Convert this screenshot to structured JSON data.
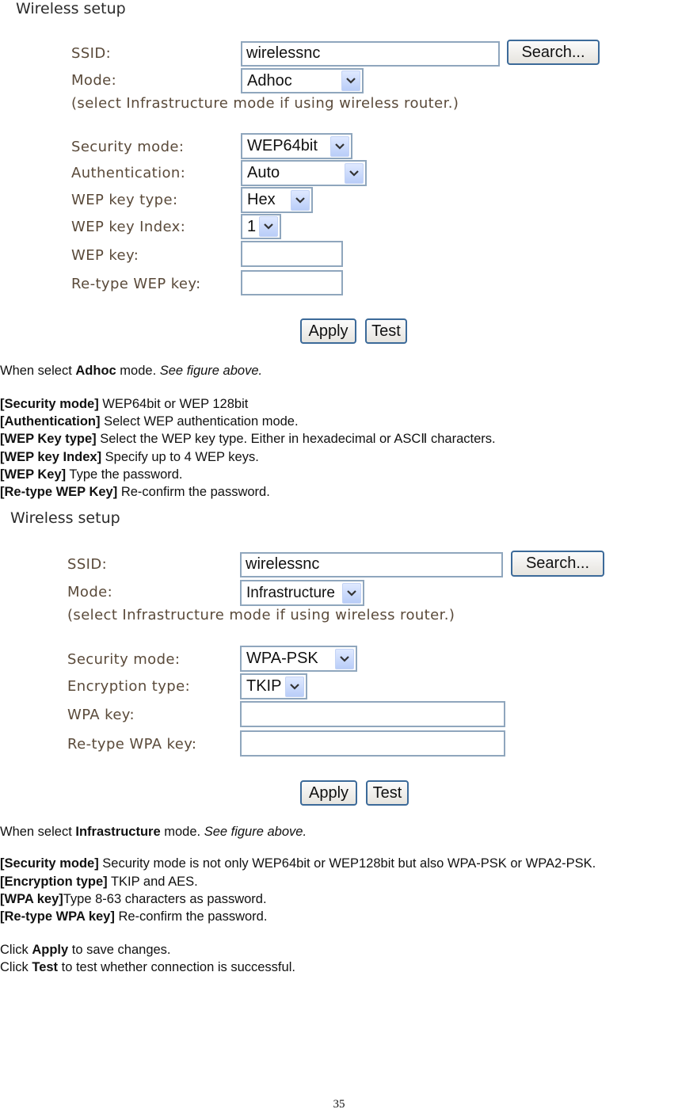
{
  "figure1": {
    "title": "Wireless setup",
    "ssid_label": "SSID:",
    "ssid_value": "wirelessnc",
    "search_button": "Search...",
    "mode_label": "Mode:",
    "mode_value": "Adhoc",
    "mode_hint": "(select Infrastructure mode if using wireless router.)",
    "security_mode_label": "Security mode:",
    "security_mode_value": "WEP64bit",
    "authentication_label": "Authentication:",
    "authentication_value": "Auto",
    "wep_key_type_label": "WEP key type:",
    "wep_key_type_value": "Hex",
    "wep_key_index_label": "WEP key Index:",
    "wep_key_index_value": "1",
    "wep_key_label": "WEP key:",
    "wep_key_value": "",
    "retype_wep_key_label": "Re-type WEP key:",
    "retype_wep_key_value": "",
    "apply_button": "Apply",
    "test_button": "Test"
  },
  "section1": {
    "intro_pre": "When select ",
    "intro_bold": "Adhoc",
    "intro_mid": " mode. ",
    "intro_italic": "See figure above.",
    "items": [
      {
        "term": "[Security mode]",
        "desc": " WEP64bit or WEP 128bit"
      },
      {
        "term": "[Authentication]",
        "desc": " Select WEP authentication mode."
      },
      {
        "term": "[WEP Key type]",
        "desc": " Select the WEP key type. Either in hexadecimal or ASCⅡ  characters."
      },
      {
        "term": "[WEP key Index]",
        "desc": " Specify up to 4 WEP keys."
      },
      {
        "term": "[WEP Key]",
        "desc": " Type the password."
      },
      {
        "term": "[Re-type WEP Key]",
        "desc": " Re-confirm the password."
      }
    ]
  },
  "figure2": {
    "title": "Wireless setup",
    "ssid_label": "SSID:",
    "ssid_value": "wirelessnc",
    "search_button": "Search...",
    "mode_label": "Mode:",
    "mode_value": "Infrastructure",
    "mode_hint": "(select Infrastructure mode if using wireless router.)",
    "security_mode_label": "Security mode:",
    "security_mode_value": "WPA-PSK",
    "encryption_type_label": "Encryption type:",
    "encryption_type_value": "TKIP",
    "wpa_key_label": "WPA key:",
    "wpa_key_value": "",
    "retype_wpa_key_label": "Re-type WPA key:",
    "retype_wpa_key_value": "",
    "apply_button": "Apply",
    "test_button": "Test"
  },
  "section2": {
    "intro_pre": "When select ",
    "intro_bold": "Infrastructure",
    "intro_mid": " mode. ",
    "intro_italic": "See figure above.",
    "items": [
      {
        "term": "[Security mode]",
        "desc": " Security mode is not only WEP64bit or WEP128bit but also WPA-PSK or WPA2-PSK."
      },
      {
        "term": "[Encryption type]",
        "desc": " TKIP and AES."
      },
      {
        "term": "[WPA key]",
        "desc": "Type 8-63 characters as password."
      },
      {
        "term": "[Re-type WPA key]",
        "desc": " Re-confirm the password."
      }
    ],
    "apply_pre": "Click ",
    "apply_bold": "Apply",
    "apply_post": " to save changes.",
    "test_pre": "Click ",
    "test_bold": "Test",
    "test_post": " to test whether connection is successful."
  },
  "page_number": "35"
}
